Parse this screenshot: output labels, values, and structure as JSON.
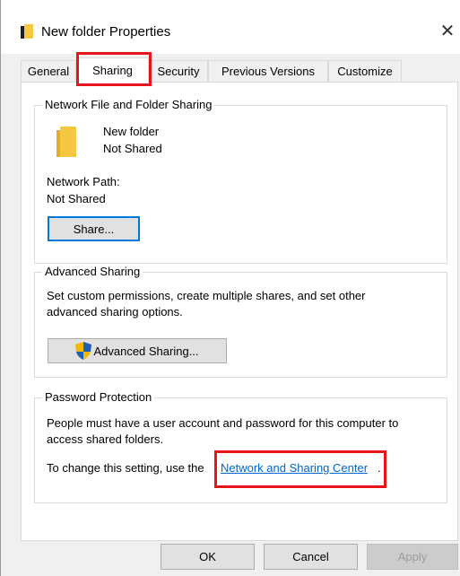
{
  "window": {
    "title": "New folder Properties",
    "close_symbol": "✕"
  },
  "tabs": [
    {
      "label": "General",
      "active": false
    },
    {
      "label": "Sharing",
      "active": true
    },
    {
      "label": "Security",
      "active": false
    },
    {
      "label": "Previous Versions",
      "active": false
    },
    {
      "label": "Customize",
      "active": false
    }
  ],
  "network_sharing": {
    "group_label": "Network File and Folder Sharing",
    "folder_name": "New folder",
    "share_status": "Not Shared",
    "network_path_label": "Network Path:",
    "network_path_value": "Not Shared",
    "share_button": "Share..."
  },
  "advanced_sharing": {
    "group_label": "Advanced Sharing",
    "description_line1": "Set custom permissions, create multiple shares, and set other",
    "description_line2": "advanced sharing options.",
    "button": "Advanced Sharing..."
  },
  "password_protection": {
    "group_label": "Password Protection",
    "description_line1": "People must have a user account and password for this computer to",
    "description_line2": "access shared folders.",
    "change_text": "To change this setting, use the",
    "link_text": "Network and Sharing Center",
    "link_suffix": "."
  },
  "footer": {
    "ok": "OK",
    "cancel": "Cancel",
    "apply": "Apply"
  },
  "colors": {
    "highlight": "#e8141c",
    "link": "#0066cc",
    "focus": "#0078d7",
    "folder": "#f5c842"
  },
  "icons": {
    "title": "folder-icon",
    "folder": "folder-icon",
    "shield": "uac-shield-icon"
  }
}
